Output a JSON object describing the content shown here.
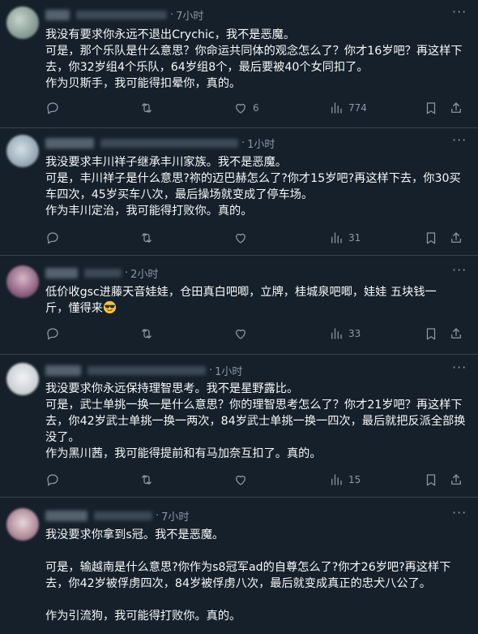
{
  "tweets": [
    {
      "time": "7小时",
      "text": "我没有要求你永远不退出Crychic，我不是恶魔。\n可是，那个乐队是什么意思？你命运共同体的观念怎么了？你才16岁吧？再这样下去，你32岁组4个乐队，64岁组8个，最后要被40个女同扣了。\n作为贝斯手，我可能得扣晕你，真的。",
      "likes": "6",
      "views": "774",
      "avatar_color": "#9fb0a8"
    },
    {
      "time": "1小时",
      "text": "我没要求丰川祥子继承丰川家族。我不是恶魔。\n可是，丰川祥子是什么意思?祢的迈巴赫怎么了?你才15岁吧?再这样下去，你30买车四次，45岁买车八次，最后操场就变成了停车场。\n作为丰川定治，我可能得打败你。真的。",
      "likes": "",
      "views": "31",
      "avatar_color": "#a9b8c2"
    },
    {
      "time": "2小时",
      "text": "低价收gsc进藤天音娃娃，仓田真白吧唧，立牌，桂城泉吧唧，娃娃 五块钱一斤，懂得来",
      "likes": "",
      "views": "33",
      "avatar_color": "#8a6f86"
    },
    {
      "time": "1小时",
      "text": "我没要求你永远保持理智思考。我不是星野露比。\n可是，武士单挑一换一是什么意思？你的理智思考怎么了？你才21岁吧？再这样下去，你42岁武士单挑一换一两次，84岁武士单挑一换一四次，最后就把反派全部换没了。\n作为黑川茜，我可能得提前和有马加奈互扣了。真的。",
      "likes": "",
      "views": "15",
      "avatar_color": "#c9cdd0"
    },
    {
      "time": "7小时",
      "text": "我没要求你拿到s冠。我不是恶魔。\n\n可是，输越南是什么意思?你作为s8冠军ad的自尊怎么了?你才26岁吧?再这样下去，你42岁被俘虏四次，84岁被俘虏八次，最后就变成真正的忠犬八公了。\n\n作为引流狗，我可能得打败你。真的。",
      "likes": "",
      "views": "",
      "avatar_color": "#b59aa6"
    }
  ],
  "icons": {
    "reply": "reply-icon",
    "retweet": "retweet-icon",
    "like": "heart-icon",
    "views": "views-icon",
    "bookmark": "bookmark-icon",
    "share": "share-icon",
    "more": "more-icon"
  },
  "colors": {
    "background": "#15202b",
    "text": "#f7f9f9",
    "muted": "#8b98a5",
    "divider": "#38444d"
  }
}
